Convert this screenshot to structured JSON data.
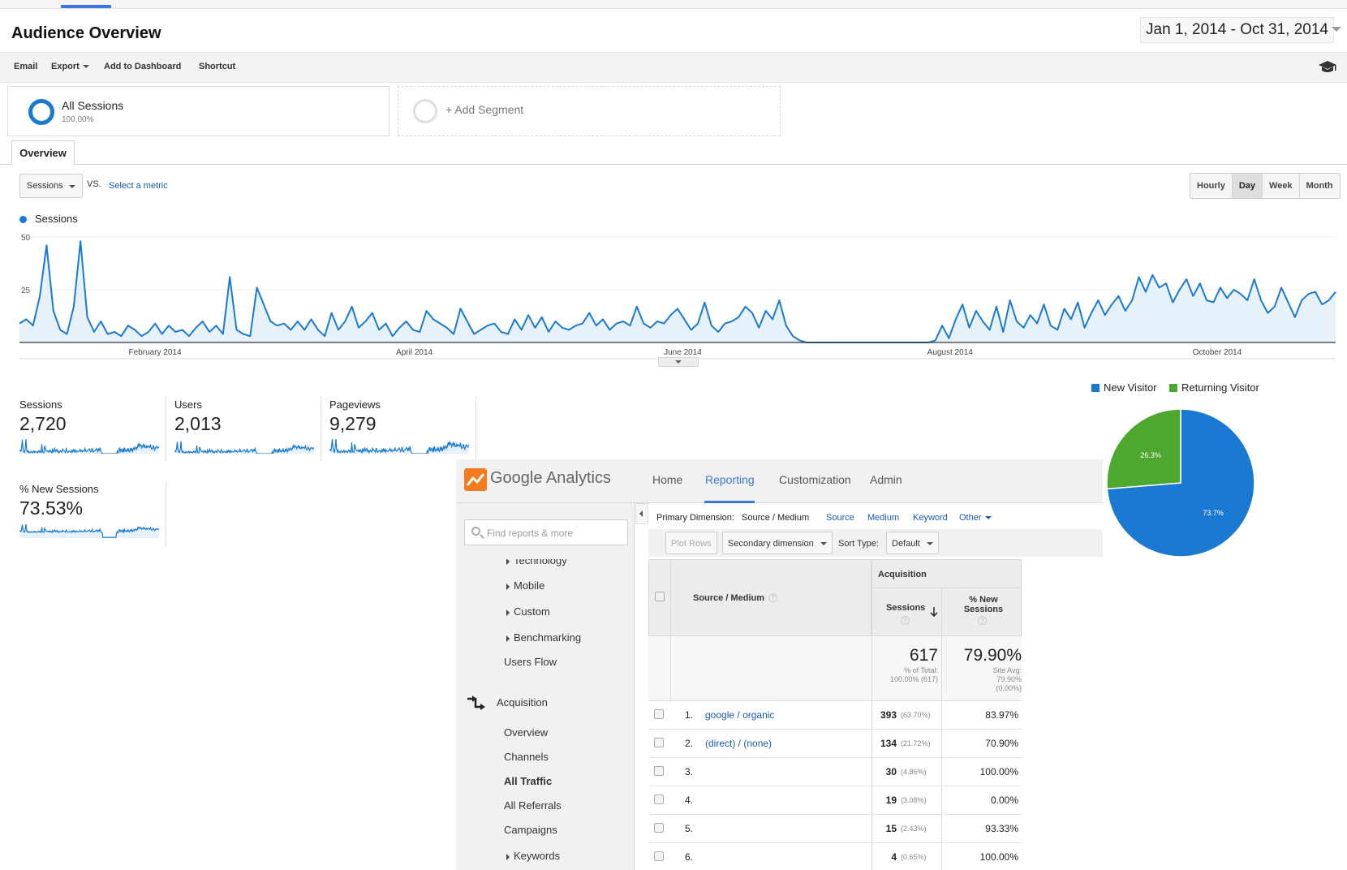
{
  "header": {
    "title": "Audience Overview",
    "date_range": "Jan 1, 2014 - Oct 31, 2014",
    "toolbar": [
      "Email",
      "Export",
      "Add to Dashboard",
      "Shortcut"
    ]
  },
  "segments": {
    "all": {
      "name": "All Sessions",
      "pct": "100.00%"
    },
    "add": {
      "label": "+ Add Segment"
    }
  },
  "overview_tab": "Overview",
  "metric_picker": {
    "selected": "Sessions",
    "vs": "VS.",
    "select_metric": "Select a metric"
  },
  "period_buttons": [
    "Hourly",
    "Day",
    "Week",
    "Month"
  ],
  "active_period": "Day",
  "colors": {
    "accent": "#1a7ad1",
    "returning": "#4ea72e",
    "link": "#1a5aa8",
    "area": "#e6f1f9"
  },
  "chart_data": [
    {
      "type": "area",
      "legend": "Sessions",
      "y_ticks": [
        50,
        25
      ],
      "ylim": [
        0,
        50
      ],
      "x_ticks": [
        "February 2014",
        "April 2014",
        "June 2014",
        "August 2014",
        "October 2014"
      ],
      "y_sample": [
        9,
        11,
        8,
        22,
        46,
        15,
        6,
        4,
        17,
        48,
        12,
        5,
        10,
        4,
        5,
        3,
        8,
        6,
        3,
        5,
        9,
        4,
        8,
        5,
        6,
        3,
        7,
        10,
        5,
        8,
        4,
        31,
        6,
        4,
        3,
        26,
        18,
        10,
        8,
        9,
        6,
        10,
        6,
        11,
        6,
        3,
        14,
        6,
        10,
        17,
        7,
        10,
        14,
        6,
        9,
        3,
        7,
        10,
        6,
        5,
        15,
        11,
        9,
        7,
        4,
        16,
        10,
        4,
        6,
        8,
        9,
        5,
        4,
        11,
        6,
        13,
        7,
        12,
        5,
        10,
        7,
        6,
        8,
        9,
        14,
        8,
        11,
        6,
        9,
        10,
        8,
        17,
        9,
        7,
        10,
        9,
        13,
        16,
        11,
        6,
        9,
        19,
        8,
        5,
        9,
        10,
        12,
        17,
        14,
        7,
        15,
        11,
        20,
        8,
        3,
        1,
        0,
        0,
        0,
        0,
        0,
        0,
        0,
        0,
        0,
        0,
        0,
        0,
        0,
        0,
        0,
        0,
        0,
        0,
        0,
        1,
        8,
        2,
        11,
        18,
        7,
        15,
        10,
        6,
        17,
        5,
        20,
        10,
        7,
        13,
        9,
        18,
        8,
        6,
        16,
        11,
        19,
        7,
        14,
        20,
        13,
        18,
        22,
        15,
        20,
        31,
        24,
        32,
        26,
        28,
        19,
        25,
        30,
        22,
        28,
        20,
        19,
        26,
        21,
        25,
        23,
        20,
        30,
        20,
        14,
        17,
        26,
        19,
        12,
        20,
        23,
        24,
        18,
        20,
        24
      ]
    },
    {
      "type": "pie",
      "legend": [
        "New Visitor",
        "Returning Visitor"
      ],
      "slices": [
        {
          "name": "New Visitor",
          "value": 73.7,
          "label": "73.7%"
        },
        {
          "name": "Returning Visitor",
          "value": 26.3,
          "label": "26.3%"
        }
      ]
    }
  ],
  "scorecards": [
    {
      "label": "Sessions",
      "value": "2,720"
    },
    {
      "label": "Users",
      "value": "2,013"
    },
    {
      "label": "Pageviews",
      "value": "9,279"
    },
    {
      "label": "% New Sessions",
      "value": "73.53%"
    }
  ],
  "ga": {
    "brand": "Google Analytics",
    "nav": [
      "Home",
      "Reporting",
      "Customization",
      "Admin"
    ],
    "active_nav": "Reporting",
    "search_placeholder": "Find reports & more",
    "sidebar": {
      "technology": "Technology",
      "mobile": "Mobile",
      "custom": "Custom",
      "benchmarking": "Benchmarking",
      "users_flow": "Users Flow",
      "acquisition": "Acquisition",
      "overview": "Overview",
      "channels": "Channels",
      "all_traffic": "All Traffic",
      "all_referrals": "All Referrals",
      "campaigns": "Campaigns",
      "keywords": "Keywords"
    },
    "dimension_bar": {
      "label": "Primary Dimension:",
      "active": "Source / Medium",
      "options": [
        "Source",
        "Medium",
        "Keyword",
        "Other"
      ]
    },
    "controls": {
      "plot_rows": "Plot Rows",
      "secondary": "Secondary dimension",
      "sort_label": "Sort Type:",
      "sort_value": "Default"
    },
    "table": {
      "group_header": "Acquisition",
      "col_source": "Source / Medium",
      "col_sessions": "Sessions",
      "col_new": "% New Sessions",
      "totals": {
        "sessions": "617",
        "sessions_note": "% of Total: 100.00% (617)",
        "new": "79.90%",
        "new_note": "Site Avg: 79.90% (0.00%)"
      },
      "rows": [
        {
          "num": "1.",
          "source": "google",
          "medium": "organic",
          "sessions": "393",
          "share": "(63.70%)",
          "new": "83.97%"
        },
        {
          "num": "2.",
          "source": "(direct)",
          "medium": "(none)",
          "sessions": "134",
          "share": "(21.72%)",
          "new": "70.90%"
        },
        {
          "num": "3.",
          "source": "",
          "medium": "",
          "sessions": "30",
          "share": "(4.86%)",
          "new": "100.00%"
        },
        {
          "num": "4.",
          "source": "",
          "medium": "",
          "sessions": "19",
          "share": "(3.08%)",
          "new": "0.00%"
        },
        {
          "num": "5.",
          "source": "",
          "medium": "",
          "sessions": "15",
          "share": "(2.43%)",
          "new": "93.33%"
        },
        {
          "num": "6.",
          "source": "",
          "medium": "",
          "sessions": "4",
          "share": "(0.65%)",
          "new": "100.00%"
        }
      ]
    }
  }
}
